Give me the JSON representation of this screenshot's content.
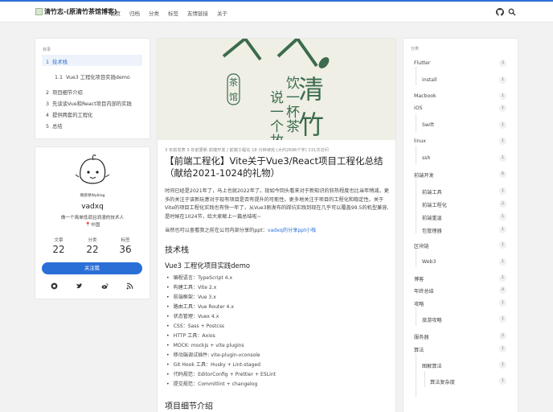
{
  "site": {
    "title": "清竹志-(原清竹茶馆博客)"
  },
  "nav": [
    "首页",
    "归档",
    "分类",
    "标签",
    "友情链接",
    "关于"
  ],
  "toc": {
    "heading": "目录",
    "items": [
      {
        "num": "1",
        "text": "技术栈"
      },
      {
        "num": "1.1",
        "text": "Vue3 工程化项目实践demo"
      },
      {
        "num": "2",
        "text": "项目细节介绍"
      },
      {
        "num": "3",
        "text": "先谈谈Vue和React项目内部的实践"
      },
      {
        "num": "4",
        "text": "提供两套的工程化"
      },
      {
        "num": "5",
        "text": "总结"
      }
    ]
  },
  "profile": {
    "avatar_caption": "情感领Wyblog",
    "name": "vadxq",
    "bio": "做一个简单低调且浪漫的技术人",
    "location": "中国",
    "stats": [
      {
        "label": "文章",
        "value": "22"
      },
      {
        "label": "分类",
        "value": "22"
      },
      {
        "label": "标签",
        "value": "36"
      }
    ],
    "follow": "关注我"
  },
  "hero": {
    "text_cha": "茶",
    "text_guan": "馆",
    "text_qing": "清",
    "text_zhu": "竹",
    "col1": "饮一杯茶",
    "col2": "说一个故事"
  },
  "post": {
    "meta": "3 年前发表   3 年前更新   前端开发 / 前端工程化   18 分钟读完 (大约2696个字)   131次访问",
    "title": "【前端工程化】Vite关于Vue3/React项目工程化总结（献给2021-1024的礼物）",
    "intro": "时间已经是2021年了，马上也就2022年了。现如今回头看来对于新知识的狂热程度也比当年稍减，更多的关注于该新玩意对于现有项目是否有提升的可能性。更多地关注于项目的工程化和稳定性。关于Vite的项目工程化实践也有快一年了，从Vue3刚发布的踩坑实践到现在几乎可以覆盖99.5的机型兼容,是时候在1024节，给大家献上一篇总结啦~",
    "share_prefix": "当然也可以查看我之前在公司内部分享的ppt：",
    "share_link": "vadxq的分享ppt小栈",
    "h2_stack": "技术栈",
    "h3_demo": "Vue3 工程化项目实践demo",
    "bullets": [
      "编程语言：TypeScript 4.x",
      "构建工具：Vite 2.x",
      "前端框架：Vue 3.x",
      "路由工具：Vue Router 4.x",
      "状态管理：Vuex 4.x",
      "CSS：Sass + Postcss",
      "HTTP 工具：Axios",
      "MOCK: mockjs + vite plugins",
      "移动端调试插件: vite-plugin-vconsole",
      "Git Hook 工具：Husky + Lint-staged",
      "代码规范：EditorConfig + Prettier + ESLint",
      "提交规范：Commitlint + changelog"
    ],
    "h2_detail": "项目细节介绍"
  },
  "categories": {
    "heading": "分类",
    "items": [
      {
        "name": "Flutter",
        "count": "3",
        "level": 0
      },
      {
        "name": "install",
        "count": "1",
        "level": 1
      },
      {
        "name": "Macbook",
        "count": "1",
        "level": 0
      },
      {
        "name": "iOS",
        "count": "1",
        "level": 0
      },
      {
        "name": "Swift",
        "count": "1",
        "level": 1
      },
      {
        "name": "linux",
        "count": "1",
        "level": 0
      },
      {
        "name": "ssh",
        "count": "1",
        "level": 1
      },
      {
        "name": "前端开发",
        "count": "6",
        "level": 0
      },
      {
        "name": "前端工具",
        "count": "1",
        "level": 1
      },
      {
        "name": "前端工程化",
        "count": "2",
        "level": 1
      },
      {
        "name": "前端重温",
        "count": "1",
        "level": 1
      },
      {
        "name": "包管理器",
        "count": "1",
        "level": 1
      },
      {
        "name": "区块链",
        "count": "1",
        "level": 0
      },
      {
        "name": "Web3",
        "count": "1",
        "level": 1
      },
      {
        "name": "博客",
        "count": "1",
        "level": 0
      },
      {
        "name": "年终总结",
        "count": "4",
        "level": 0
      },
      {
        "name": "攻略",
        "count": "1",
        "level": 0
      },
      {
        "name": "旅游攻略",
        "count": "1",
        "level": 1
      },
      {
        "name": "服务器",
        "count": "2",
        "level": 0
      },
      {
        "name": "算法",
        "count": "1",
        "level": 0
      },
      {
        "name": "图解算法",
        "count": "1",
        "level": 1
      },
      {
        "name": "算法复杂度",
        "count": "1",
        "level": 2
      }
    ]
  },
  "colors": {
    "accent": "#2a6fd6",
    "hero_bg": "#efefe6",
    "hero_green": "#3c6b4e"
  }
}
